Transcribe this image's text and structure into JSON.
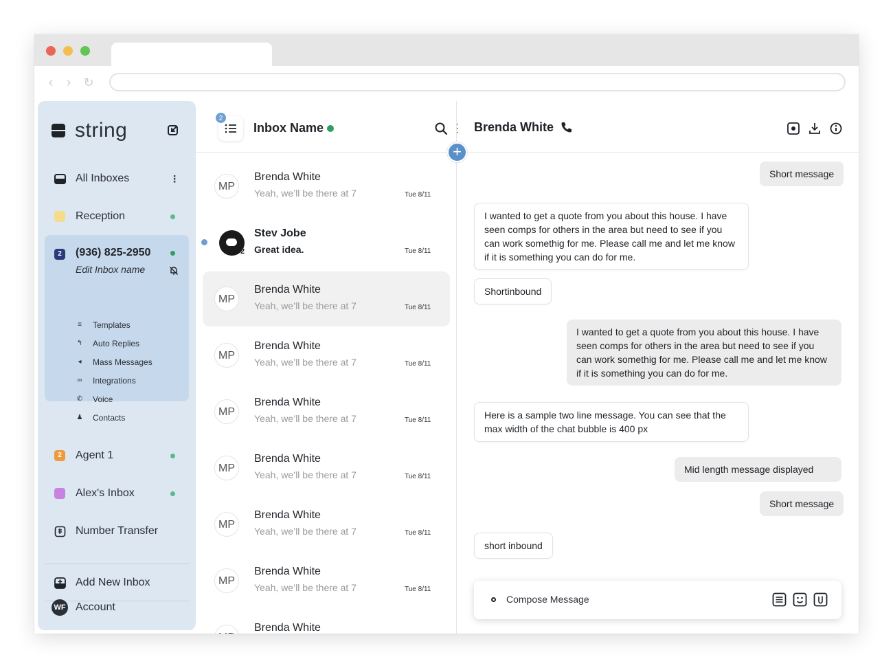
{
  "sidebar": {
    "brand": "string",
    "items": [
      {
        "label": "All Inboxes"
      },
      {
        "label": "Reception",
        "color": "#f5dc8a"
      },
      {
        "label": "Agent 1",
        "badge": "2",
        "color": "#ef9a3c"
      },
      {
        "label": "Alex's Inbox",
        "color": "#c882e0"
      },
      {
        "label": "Number Transfer"
      }
    ],
    "active_inbox": {
      "badge": "2",
      "badge_color": "#2a3a7a",
      "phone": "(936) 825-2950",
      "edit_label": "Edit Inbox name",
      "sub_items": [
        {
          "label": "Templates",
          "icon": "list-icon"
        },
        {
          "label": "Auto Replies",
          "icon": "reply-icon"
        },
        {
          "label": "Mass Messages",
          "icon": "megaphone-icon"
        },
        {
          "label": "Integrations",
          "icon": "link-icon"
        },
        {
          "label": "Voice",
          "icon": "phone-icon"
        },
        {
          "label": "Contacts",
          "icon": "person-icon"
        }
      ]
    },
    "add_inbox": "Add New Inbox",
    "account": {
      "initials": "WF",
      "label": "Account"
    }
  },
  "inbox": {
    "badge": "2",
    "title": "Inbox Name",
    "conversations": [
      {
        "initials": "MP",
        "name": "Brenda White",
        "preview": "Yeah, we’ll be there at 7",
        "time": "Tue 8/11"
      },
      {
        "name": "Stev Jobe",
        "preview": "Great idea.",
        "time": "Tue 8/11",
        "count": "2",
        "unread": true
      },
      {
        "initials": "MP",
        "name": "Brenda White",
        "preview": "Yeah, we’ll be there at 7",
        "time": "Tue 8/11",
        "selected": true
      },
      {
        "initials": "MP",
        "name": "Brenda White",
        "preview": "Yeah, we’ll be there at 7",
        "time": "Tue 8/11"
      },
      {
        "initials": "MP",
        "name": "Brenda White",
        "preview": "Yeah, we’ll be there at 7",
        "time": "Tue 8/11"
      },
      {
        "initials": "MP",
        "name": "Brenda White",
        "preview": "Yeah, we’ll be there at 7",
        "time": "Tue 8/11"
      },
      {
        "initials": "MP",
        "name": "Brenda White",
        "preview": "Yeah, we’ll be there at 7",
        "time": "Tue 8/11"
      },
      {
        "initials": "MP",
        "name": "Brenda White",
        "preview": "Yeah, we’ll be there at 7",
        "time": "Tue 8/11"
      },
      {
        "initials": "MP",
        "name": "Brenda White"
      }
    ]
  },
  "chat": {
    "contact": "Brenda White",
    "messages": [
      {
        "dir": "out",
        "text": "Short message"
      },
      {
        "dir": "in",
        "text": "I wanted to get a quote from you about this house. I have seen comps for others in the area but need to see if you can work somethig for me. Please call me and let me know if it is something you can do for me."
      },
      {
        "dir": "in",
        "text": "Shortinbound"
      },
      {
        "dir": "out",
        "text": "I wanted to get a quote from you about this house. I have seen comps for others in the area but need to see if you can work somethig for me. Please call me and let me know if it is something you can do for me."
      },
      {
        "dir": "in",
        "text": "Here is a sample two line message. You can see that the max width of the chat bubble is 400 px"
      },
      {
        "dir": "out",
        "text": "Mid length message displayed"
      },
      {
        "dir": "out",
        "text": "Short message"
      },
      {
        "dir": "in",
        "text": "short inbound"
      }
    ],
    "compose_placeholder": "Compose Message"
  },
  "colors": {
    "sidebar_bg": "#dce7f2",
    "sidebar_active": "#c6d8eb",
    "accent": "#5b8fc8",
    "online": "#2e9e62"
  }
}
